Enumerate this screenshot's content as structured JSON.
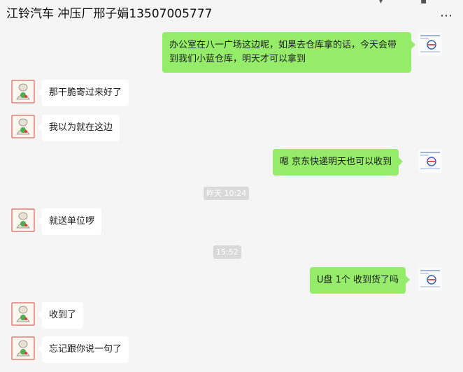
{
  "header": {
    "title": "江铃汽车 冲压厂邢子娟13507005777",
    "more_icon": "more-icon"
  },
  "messages": [
    {
      "side": "out",
      "text": "办公室在八一广场这边呢，如果去仓库拿的话，今天会带到我们小蓝仓库，明天才可以拿到"
    },
    {
      "side": "in",
      "text": "那干脆寄过来好了"
    },
    {
      "side": "in",
      "text": "我以为就在这边"
    },
    {
      "side": "out",
      "text": "嗯  京东快递明天也可以收到"
    },
    {
      "type": "time",
      "text": "昨天 10:24"
    },
    {
      "side": "in",
      "text": "就送单位啰"
    },
    {
      "type": "time",
      "text": "15:52"
    },
    {
      "side": "out",
      "text": "U盘 1个 收到货了吗"
    },
    {
      "side": "in",
      "text": "收到了"
    },
    {
      "side": "in",
      "text": "忘记跟你说一句了"
    }
  ],
  "colors": {
    "background": "#f5f5f5",
    "outgoing_bubble": "#95ec69",
    "incoming_bubble": "#ffffff",
    "timestamp_bg": "#d9d9d9"
  }
}
